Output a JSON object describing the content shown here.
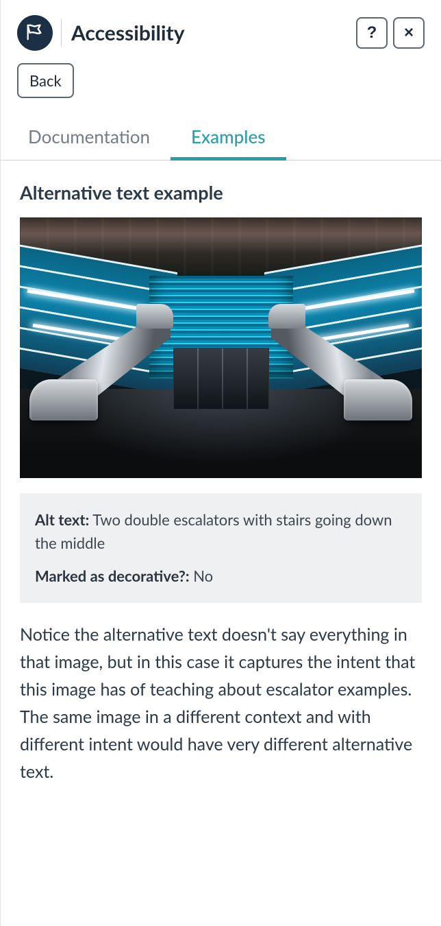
{
  "header": {
    "title": "Accessibility",
    "logo_icon": "pope-tech-logo"
  },
  "buttons": {
    "help": "?",
    "close": "×",
    "back": "Back"
  },
  "tabs": [
    {
      "label": "Documentation",
      "active": false
    },
    {
      "label": "Examples",
      "active": true
    }
  ],
  "example": {
    "section_title": "Alternative text example",
    "alt_text_label": "Alt text:",
    "alt_text_value": "Two double escalators with stairs going down the middle",
    "decorative_label": "Marked as decorative?:",
    "decorative_value": "No",
    "explanation": "Notice the alternative text doesn't say everything in that image, but in this case it captures the intent that this image has of teaching about escalator examples. The same image in a different context and with different intent would have very different alternative text."
  }
}
